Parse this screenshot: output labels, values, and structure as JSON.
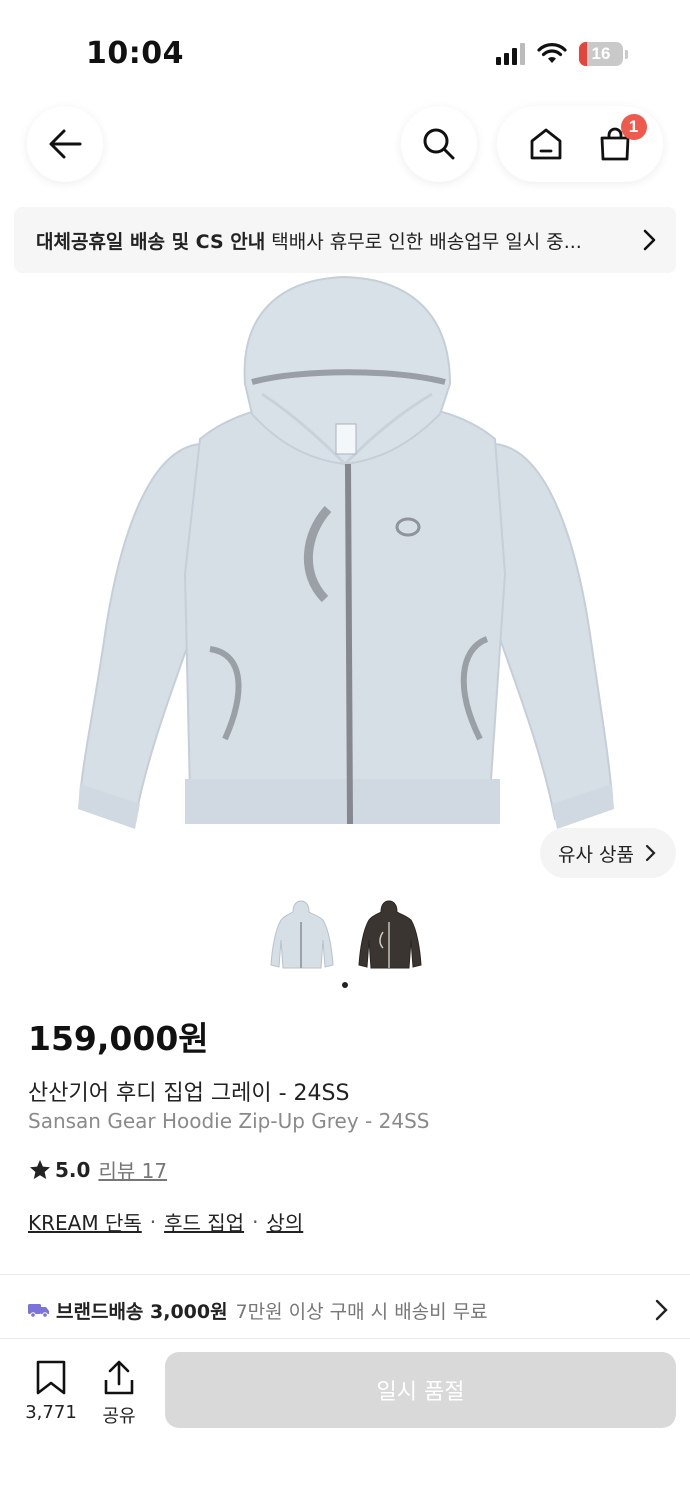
{
  "status_bar": {
    "time": "10:04",
    "battery": "16",
    "battery_color": "#e5443d"
  },
  "nav": {
    "cart_count": "1"
  },
  "notice": {
    "title": "대체공휴일 배송 및 CS 안내",
    "body": "택배사 휴무로 인한 배송업무 일시 중..."
  },
  "product": {
    "similar_label": "유사 상품",
    "price": "159,000원",
    "name_ko": "산산기어 후디 집업 그레이 - 24SS",
    "name_en": "Sansan Gear Hoodie Zip-Up Grey - 24SS",
    "rating": "5.0",
    "reviews": "리뷰 17",
    "tags": [
      "KREAM 단독",
      "후드 집업",
      "상의"
    ],
    "thumbnails": [
      "grey-hoodie",
      "brown-hoodie"
    ],
    "image_color": "#d6dee6"
  },
  "delivery": {
    "label": "브랜드배송 3,000원",
    "desc": "7만원 이상 구매 시 배송비 무료",
    "icon_color": "#7b73d9"
  },
  "bottom": {
    "bookmark_count": "3,771",
    "share_label": "공유",
    "buy_label": "일시 품절",
    "buy_color": "#d9d9d9"
  }
}
